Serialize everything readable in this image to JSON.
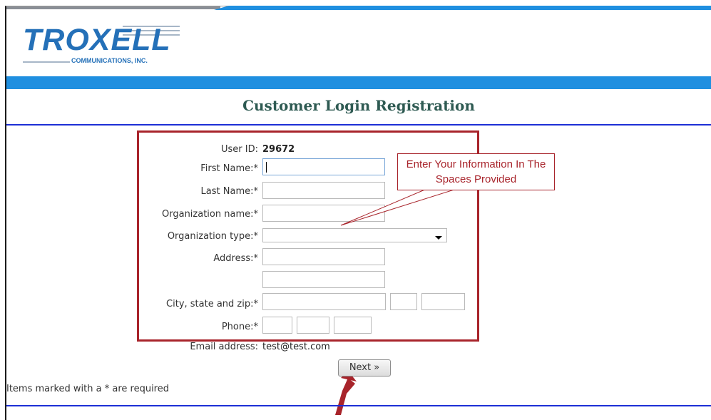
{
  "logo": {
    "word": "TROXELL",
    "sub": "COMMUNICATIONS, INC."
  },
  "page_title": "Customer Login Registration",
  "form": {
    "user_id_label": "User ID:",
    "user_id_value": "29672",
    "first_name_label": "First Name:*",
    "last_name_label": "Last Name:*",
    "org_name_label": "Organization name:*",
    "org_type_label": "Organization type:*",
    "address_label": "Address:*",
    "city_state_zip_label": "City, state and zip:*",
    "phone_label": "Phone:*",
    "email_label": "Email address:",
    "email_value": "test@test.com"
  },
  "callout_text": "Enter Your Information In The Spaces Provided",
  "next_button": "Next »",
  "required_note": "Items marked with a * are required",
  "colors": {
    "brand_blue": "#1f8fe0",
    "annotation_red": "#a8242b",
    "rule_blue": "#1d2fd6"
  }
}
